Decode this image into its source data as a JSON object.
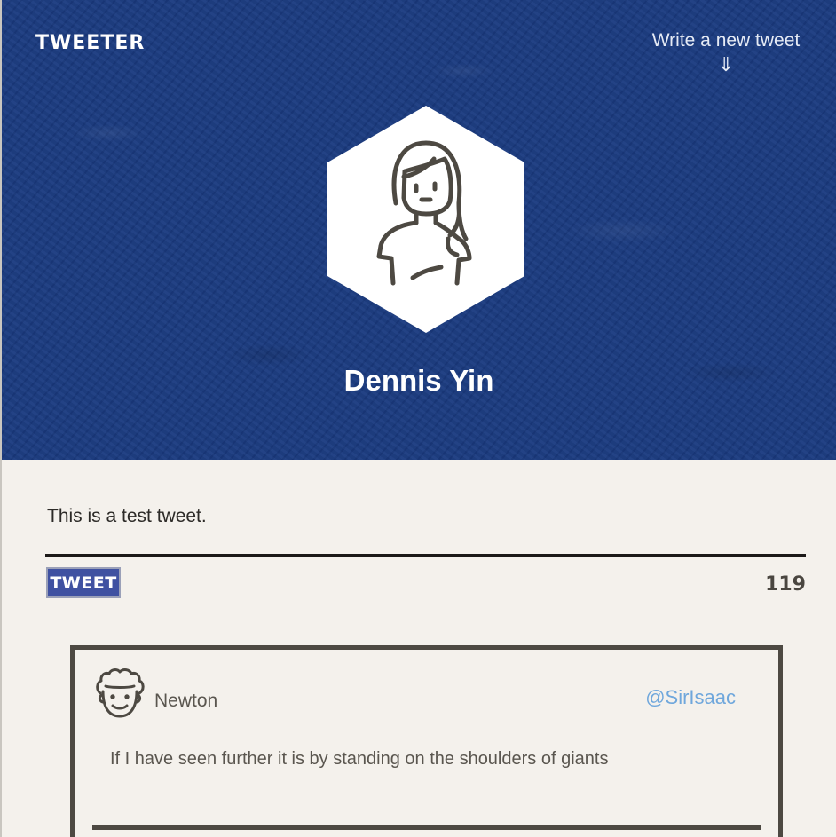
{
  "header": {
    "brand": "TWEETER",
    "compose_label": "Write a new tweet",
    "compose_arrow": "⇓"
  },
  "profile": {
    "name": "Dennis Yin",
    "avatar_icon": "woman-avatar-icon"
  },
  "composer": {
    "text": "This is a test tweet.",
    "button_label": "TWEET",
    "char_count": "119"
  },
  "tweets": [
    {
      "name": "Newton",
      "handle": "@SirIsaac",
      "text": "If I have seen further it is by standing on the shoulders of giants",
      "avatar_icon": "curly-hair-man-avatar-icon"
    }
  ],
  "colors": {
    "hero_blue": "#1a3a80",
    "button_blue": "#3f51a1",
    "background": "#f4f1ec",
    "handle_blue": "#6fa7dc",
    "dark_ink": "#4d4942"
  }
}
